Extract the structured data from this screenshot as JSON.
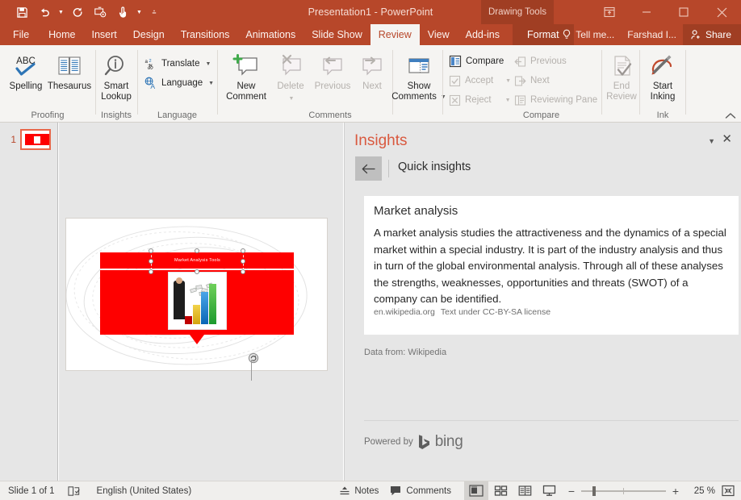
{
  "window": {
    "title": "Presentation1 - PowerPoint",
    "contextual_tab_group": "Drawing Tools",
    "minimize": "minimize-icon",
    "maximize": "maximize-icon",
    "close": "close-icon",
    "ribbon_display_options": "ribbon-display-options-icon"
  },
  "quick_access": [
    {
      "name": "save",
      "icon": "save-icon"
    },
    {
      "name": "undo",
      "icon": "undo-icon",
      "has_caret": true
    },
    {
      "name": "redo",
      "icon": "redo-icon"
    },
    {
      "name": "start-from-beginning",
      "icon": "slideshow-icon"
    },
    {
      "name": "touch-mouse-mode",
      "icon": "touch-mode-icon",
      "has_caret": true
    },
    {
      "name": "customize-quick-access-toolbar",
      "icon": "overflow-caret-icon"
    }
  ],
  "tabs": [
    {
      "label": "File",
      "active": false
    },
    {
      "label": "Home",
      "active": false
    },
    {
      "label": "Insert",
      "active": false
    },
    {
      "label": "Design",
      "active": false
    },
    {
      "label": "Transitions",
      "active": false
    },
    {
      "label": "Animations",
      "active": false
    },
    {
      "label": "Slide Show",
      "active": false
    },
    {
      "label": "Review",
      "active": true
    },
    {
      "label": "View",
      "active": false
    },
    {
      "label": "Add-ins",
      "active": false
    }
  ],
  "contextual_tab": {
    "label": "Format"
  },
  "tab_right": {
    "tell_me": "Tell me...",
    "account": "Farshad I...",
    "share": "Share"
  },
  "ribbon": {
    "collapse_label": "collapse-ribbon-icon",
    "groups": [
      {
        "name": "proofing",
        "label": "Proofing",
        "buttons": [
          {
            "name": "spelling",
            "label": "Spelling",
            "icon": "abc-check-icon",
            "disabled": false
          },
          {
            "name": "thesaurus",
            "label": "Thesaurus",
            "icon": "book-icon",
            "disabled": false
          }
        ]
      },
      {
        "name": "insights",
        "label": "Insights",
        "buttons": [
          {
            "name": "smart-lookup",
            "label": "Smart\nLookup",
            "line1": "Smart",
            "line2": "Lookup",
            "icon": "magnifier-info-icon",
            "disabled": false
          }
        ]
      },
      {
        "name": "language",
        "label": "Language",
        "buttons": [
          {
            "name": "translate",
            "label": "Translate",
            "icon": "translate-icon",
            "caret": true
          },
          {
            "name": "language",
            "label": "Language",
            "icon": "globe-a-icon",
            "caret": true
          }
        ]
      },
      {
        "name": "comments",
        "label": "Comments",
        "buttons": [
          {
            "name": "new-comment",
            "line1": "New",
            "line2": "Comment",
            "icon": "new-comment-icon",
            "disabled": false
          },
          {
            "name": "delete-comment",
            "line1": "Delete",
            "line2": "",
            "icon": "delete-comment-icon",
            "disabled": true,
            "caret": true
          },
          {
            "name": "previous-comment",
            "line1": "Previous",
            "line2": "",
            "icon": "previous-comment-icon",
            "disabled": true
          },
          {
            "name": "next-comment",
            "line1": "Next",
            "line2": "",
            "icon": "next-comment-icon",
            "disabled": true
          },
          {
            "name": "show-comments",
            "line1": "Show",
            "line2": "Comments",
            "icon": "show-comments-icon",
            "disabled": false,
            "caret": true
          }
        ]
      },
      {
        "name": "compare",
        "label": "Compare",
        "buttons": [
          {
            "name": "compare",
            "label": "Compare",
            "icon": "compare-icon",
            "disabled": false
          },
          {
            "name": "accept",
            "label": "Accept",
            "icon": "accept-icon",
            "disabled": true,
            "caret": true
          },
          {
            "name": "reject",
            "label": "Reject",
            "icon": "reject-icon",
            "disabled": true,
            "caret": true
          },
          {
            "name": "previous-change",
            "label": "Previous",
            "icon": "previous-change-icon",
            "disabled": true
          },
          {
            "name": "next-change",
            "label": "Next",
            "icon": "next-change-icon",
            "disabled": true
          },
          {
            "name": "reviewing-pane",
            "label": "Reviewing Pane",
            "icon": "reviewing-pane-icon",
            "disabled": true
          },
          {
            "name": "end-review",
            "line1": "End",
            "line2": "Review",
            "icon": "end-review-icon",
            "disabled": true
          }
        ]
      },
      {
        "name": "ink",
        "label": "Ink",
        "buttons": [
          {
            "name": "start-inking",
            "line1": "Start",
            "line2": "Inking",
            "icon": "pen-icon",
            "disabled": false
          }
        ]
      }
    ]
  },
  "thumbnails": [
    {
      "number": "1",
      "selected": true
    }
  ],
  "slide": {
    "title_text": "Market Analysis Tools",
    "title_selected": true,
    "rotate_handle": "rotate-handle-icon",
    "picture_alt": "businessman-with-bar-chart-and-money"
  },
  "insights_pane": {
    "title": "Insights",
    "dropdown_icon": "chevron-down-icon",
    "close_icon": "close-icon",
    "back_icon": "back-arrow-icon",
    "section_title": "Quick insights",
    "card": {
      "heading": "Market analysis",
      "body": "A market analysis studies the attractiveness and the dynamics of a special market within a special industry. It is part of the industry analysis and thus in turn of the global environmental analysis. Through all of these analyses the strengths, weaknesses, opportunities and threats (SWOT) of a company can be identified.",
      "source": "en.wikipedia.org",
      "license": "Text under CC-BY-SA license"
    },
    "data_from": "Data from: Wikipedia",
    "powered_by_label": "Powered by",
    "powered_by_brand": "bing"
  },
  "status_bar": {
    "slide_count": "Slide 1 of 1",
    "accessibility_icon": "accessibility-check-icon",
    "language": "English (United States)",
    "notes_label": "Notes",
    "notes_icon": "notes-icon",
    "comments_label": "Comments",
    "comments_icon": "comments-icon",
    "views": [
      {
        "name": "normal-view",
        "icon": "normal-view-icon",
        "selected": true
      },
      {
        "name": "slide-sorter-view",
        "icon": "slide-sorter-icon",
        "selected": false
      },
      {
        "name": "reading-view",
        "icon": "reading-view-icon",
        "selected": false
      },
      {
        "name": "slide-show-view",
        "icon": "slide-show-icon",
        "selected": false
      }
    ],
    "zoom_out": "−",
    "zoom_in": "+",
    "zoom_level": "25 %",
    "fit_slide_icon": "fit-to-window-icon"
  },
  "colors": {
    "accent": "#b7472a",
    "accent_dark": "#a03e23",
    "insights_title": "#d9593f",
    "slide_red": "#fe0000",
    "ribbon_bg": "#f5f4f2",
    "pane_bg": "#e6e6e6"
  }
}
